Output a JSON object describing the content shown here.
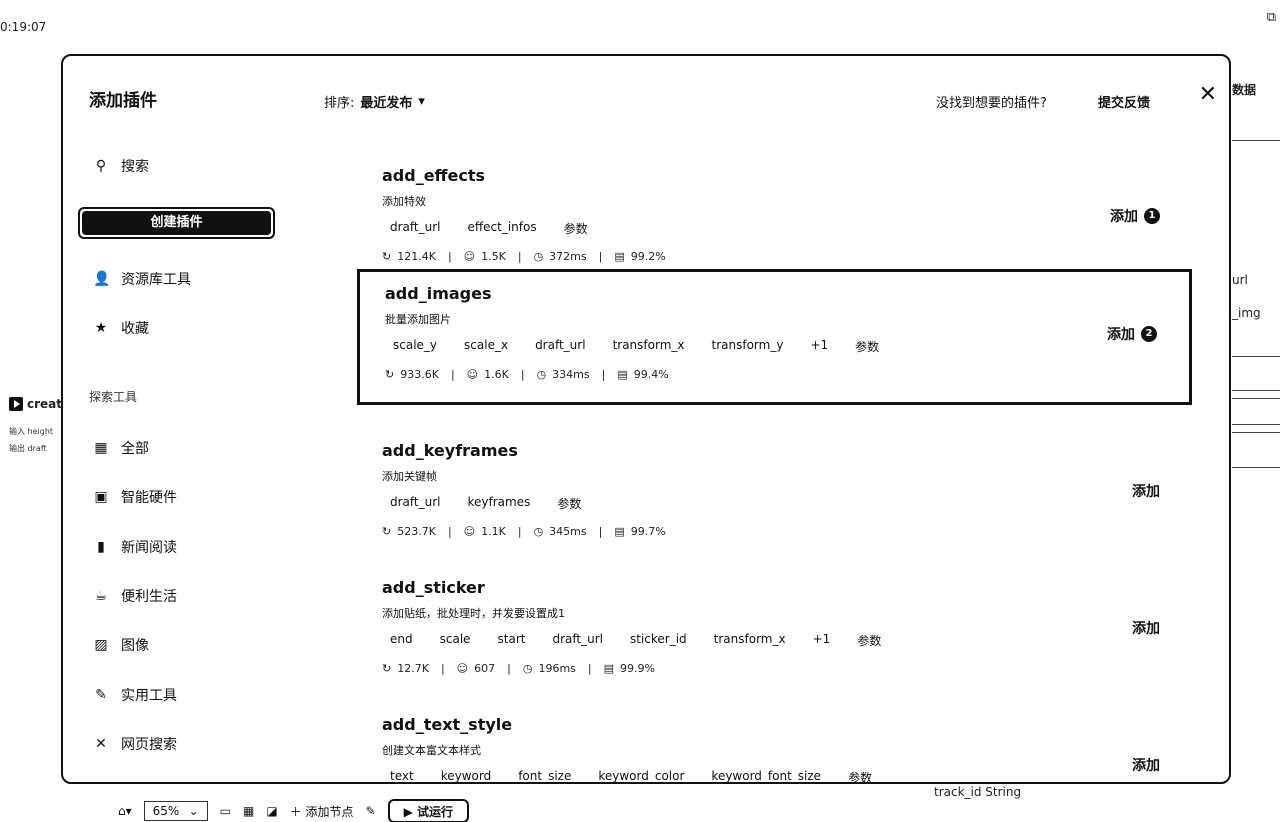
{
  "background": {
    "time": "0:19:07",
    "right_title": "数据",
    "right_labels": [
      "url",
      "_img"
    ],
    "create_label": "create",
    "input_label": "输入",
    "input_value": "height",
    "output_label": "输出",
    "output_value": "draft",
    "track": "track_id  String"
  },
  "toolbar": {
    "zoom": "65%",
    "add_node": "添加节点",
    "run": "试运行"
  },
  "modal": {
    "title": "添加插件",
    "sort_label": "排序:",
    "sort_value": "最近发布",
    "feedback_question": "没找到想要的插件?",
    "feedback_button": "提交反馈",
    "search_placeholder": "搜索",
    "create_button": "创建插件",
    "sidebar_top": [
      {
        "icon": "user-icon",
        "glyph": "👤",
        "label": "资源库工具"
      },
      {
        "icon": "star-icon",
        "glyph": "★",
        "label": "收藏"
      }
    ],
    "explore_title": "探索工具",
    "sidebar_categories": [
      {
        "icon": "grid-icon",
        "glyph": "▦",
        "label": "全部"
      },
      {
        "icon": "chip-icon",
        "glyph": "▣",
        "label": "智能硬件"
      },
      {
        "icon": "book-icon",
        "glyph": "▮",
        "label": "新闻阅读"
      },
      {
        "icon": "cup-icon",
        "glyph": "☕",
        "label": "便利生活"
      },
      {
        "icon": "image-icon",
        "glyph": "▨",
        "label": "图像"
      },
      {
        "icon": "wrench-icon",
        "glyph": "✎",
        "label": "实用工具"
      },
      {
        "icon": "globe-icon",
        "glyph": "✕",
        "label": "网页搜索"
      }
    ],
    "plugins": [
      {
        "name": "add_effects",
        "desc": "添加特效",
        "tags": [
          "draft_url",
          "effect_infos",
          "参数"
        ],
        "stats": {
          "uses": "121.4K",
          "bots": "1.5K",
          "latency": "372ms",
          "success": "99.2%"
        },
        "add": "添加",
        "badge": "1"
      },
      {
        "name": "add_images",
        "desc": "批量添加图片",
        "tags": [
          "scale_y",
          "scale_x",
          "draft_url",
          "transform_x",
          "transform_y",
          "+1",
          "参数"
        ],
        "stats": {
          "uses": "933.6K",
          "bots": "1.6K",
          "latency": "334ms",
          "success": "99.4%"
        },
        "add": "添加",
        "badge": "2"
      },
      {
        "name": "add_keyframes",
        "desc": "添加关键帧",
        "tags": [
          "draft_url",
          "keyframes",
          "参数"
        ],
        "stats": {
          "uses": "523.7K",
          "bots": "1.1K",
          "latency": "345ms",
          "success": "99.7%"
        },
        "add": "添加",
        "badge": ""
      },
      {
        "name": "add_sticker",
        "desc": "添加贴纸，批处理时，并发要设置成1",
        "tags": [
          "end",
          "scale",
          "start",
          "draft_url",
          "sticker_id",
          "transform_x",
          "+1",
          "参数"
        ],
        "stats": {
          "uses": "12.7K",
          "bots": "607",
          "latency": "196ms",
          "success": "99.9%"
        },
        "add": "添加",
        "badge": ""
      },
      {
        "name": "add_text_style",
        "desc": "创建文本富文本样式",
        "tags": [
          "text",
          "keyword",
          "font_size",
          "keyword_color",
          "keyword_font_size",
          "参数"
        ],
        "stats": {
          "uses": "",
          "bots": "",
          "latency": "",
          "success": ""
        },
        "add": "添加",
        "badge": ""
      }
    ]
  }
}
